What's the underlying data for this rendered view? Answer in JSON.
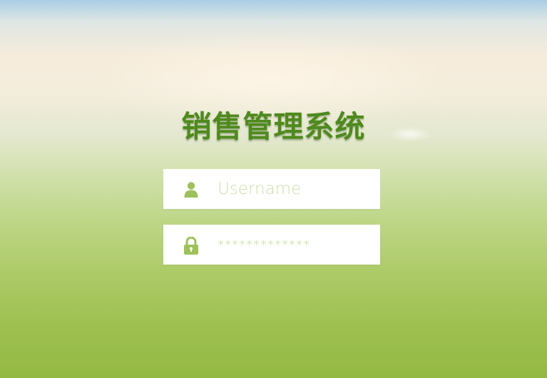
{
  "app": {
    "title": "销售管理系统"
  },
  "login": {
    "username": {
      "value": "",
      "placeholder": "Username",
      "icon": "user-icon"
    },
    "password": {
      "value": "",
      "placeholder": "*************",
      "icon": "lock-icon"
    }
  },
  "colors": {
    "title": "#4e8a1d",
    "icon": "#9dc15b",
    "placeholder": "#c9deaa",
    "field_bg": "#ffffff"
  }
}
